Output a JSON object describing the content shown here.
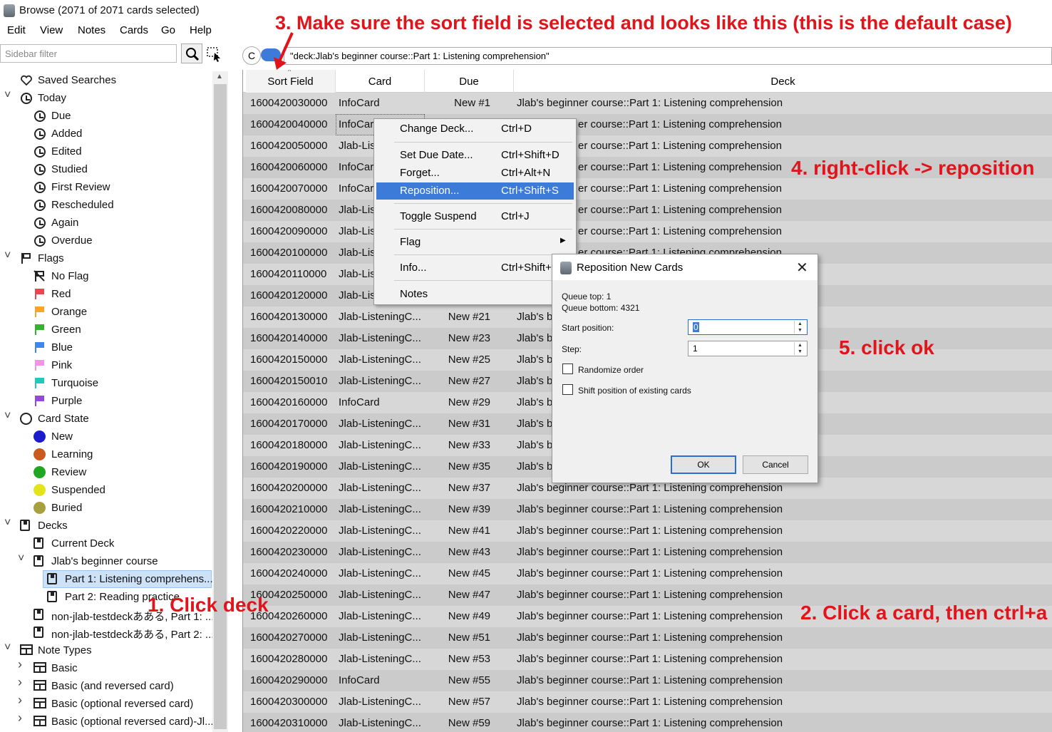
{
  "window": {
    "title": "Browse (2071 of 2071 cards selected)"
  },
  "menubar": {
    "items": [
      "Edit",
      "View",
      "Notes",
      "Cards",
      "Go",
      "Help"
    ]
  },
  "sidebar": {
    "filter_placeholder": "Sidebar filter",
    "tree": [
      {
        "label": "Saved Searches",
        "icon": "heart-icon"
      },
      {
        "label": "Today",
        "icon": "clock-icon"
      },
      {
        "label": "Due",
        "icon": "clock-icon"
      },
      {
        "label": "Added",
        "icon": "clock-icon"
      },
      {
        "label": "Edited",
        "icon": "clock-icon"
      },
      {
        "label": "Studied",
        "icon": "clock-icon"
      },
      {
        "label": "First Review",
        "icon": "clock-icon"
      },
      {
        "label": "Rescheduled",
        "icon": "clock-icon"
      },
      {
        "label": "Again",
        "icon": "clock-icon"
      },
      {
        "label": "Overdue",
        "icon": "clock-icon"
      },
      {
        "label": "Flags",
        "icon": "flag-icon"
      },
      {
        "label": "No Flag",
        "icon": "no-flag-icon"
      },
      {
        "label": "Red",
        "icon": "flag-icon",
        "color": "#e8474d"
      },
      {
        "label": "Orange",
        "icon": "flag-icon",
        "color": "#f5a623"
      },
      {
        "label": "Green",
        "icon": "flag-icon",
        "color": "#35b22f"
      },
      {
        "label": "Blue",
        "icon": "flag-icon",
        "color": "#3f86ee"
      },
      {
        "label": "Pink",
        "icon": "flag-icon",
        "color": "#f293e7"
      },
      {
        "label": "Turquoise",
        "icon": "flag-icon",
        "color": "#22c8b9"
      },
      {
        "label": "Purple",
        "icon": "flag-icon",
        "color": "#9449d9"
      },
      {
        "label": "Card State",
        "icon": "circle-icon"
      },
      {
        "label": "New",
        "icon": "dot-icon",
        "color": "#1c1ccc"
      },
      {
        "label": "Learning",
        "icon": "dot-icon",
        "color": "#cc5a1c"
      },
      {
        "label": "Review",
        "icon": "dot-icon",
        "color": "#1fa81f"
      },
      {
        "label": "Suspended",
        "icon": "dot-icon",
        "color": "#e4e41a"
      },
      {
        "label": "Buried",
        "icon": "dot-icon",
        "color": "#a8a03e"
      },
      {
        "label": "Decks",
        "icon": "deck-icon"
      },
      {
        "label": "Current Deck",
        "icon": "current-deck-icon"
      },
      {
        "label": "Jlab's beginner course",
        "icon": "deck-icon"
      },
      {
        "label": "Part 1: Listening comprehens...",
        "icon": "deck-icon"
      },
      {
        "label": "Part 2: Reading practice",
        "icon": "deck-icon"
      },
      {
        "label": "non-jlab-testdeckあある, Part 1: ...",
        "icon": "deck-icon"
      },
      {
        "label": "non-jlab-testdeckあある, Part 2: ...",
        "icon": "deck-icon"
      },
      {
        "label": "Note Types",
        "icon": "notetype-icon"
      },
      {
        "label": "Basic",
        "icon": "notetype-icon"
      },
      {
        "label": "Basic (and reversed card)",
        "icon": "notetype-icon"
      },
      {
        "label": "Basic (optional reversed card)",
        "icon": "notetype-icon"
      },
      {
        "label": "Basic (optional reversed card)-Jl...",
        "icon": "notetype-icon"
      }
    ]
  },
  "search": {
    "mode_button": "C",
    "query": "\"deck:Jlab's beginner course::Part 1: Listening comprehension\""
  },
  "table": {
    "columns": [
      "Sort Field",
      "Card",
      "Due",
      "Deck"
    ],
    "rows": [
      [
        "1600420030000",
        "InfoCard",
        "New #1",
        "Jlab's beginner course::Part 1: Listening comprehension"
      ],
      [
        "1600420040000",
        "InfoCar",
        "",
        "er course::Part 1: Listening comprehension"
      ],
      [
        "1600420050000",
        "Jlab-Lis",
        "",
        "er course::Part 1: Listening comprehension"
      ],
      [
        "1600420060000",
        "InfoCar",
        "",
        "er course::Part 1: Listening comprehension"
      ],
      [
        "1600420070000",
        "InfoCar",
        "",
        "er course::Part 1: Listening comprehension"
      ],
      [
        "1600420080000",
        "Jlab-Lis",
        "",
        "er course::Part 1: Listening comprehension"
      ],
      [
        "1600420090000",
        "Jlab-Lis",
        "",
        "er course::Part 1: Listening comprehension"
      ],
      [
        "1600420100000",
        "Jlab-Lis",
        "",
        "er course::Part 1: Listening comprehension"
      ],
      [
        "1600420110000",
        "Jlab-Lis",
        "",
        ""
      ],
      [
        "1600420120000",
        "Jlab-Lis",
        "",
        ""
      ],
      [
        "1600420130000",
        "Jlab-ListeningC...",
        "New #21",
        "Jlab's b"
      ],
      [
        "1600420140000",
        "Jlab-ListeningC...",
        "New #23",
        "Jlab's b"
      ],
      [
        "1600420150000",
        "Jlab-ListeningC...",
        "New #25",
        "Jlab's b"
      ],
      [
        "1600420150010",
        "Jlab-ListeningC...",
        "New #27",
        "Jlab's b"
      ],
      [
        "1600420160000",
        "InfoCard",
        "New #29",
        "Jlab's b"
      ],
      [
        "1600420170000",
        "Jlab-ListeningC...",
        "New #31",
        "Jlab's b"
      ],
      [
        "1600420180000",
        "Jlab-ListeningC...",
        "New #33",
        "Jlab's b"
      ],
      [
        "1600420190000",
        "Jlab-ListeningC...",
        "New #35",
        "Jlab's b"
      ],
      [
        "1600420200000",
        "Jlab-ListeningC...",
        "New #37",
        "Jlab's beginner course::Part 1: Listening comprehension"
      ],
      [
        "1600420210000",
        "Jlab-ListeningC...",
        "New #39",
        "Jlab's beginner course::Part 1: Listening comprehension"
      ],
      [
        "1600420220000",
        "Jlab-ListeningC...",
        "New #41",
        "Jlab's beginner course::Part 1: Listening comprehension"
      ],
      [
        "1600420230000",
        "Jlab-ListeningC...",
        "New #43",
        "Jlab's beginner course::Part 1: Listening comprehension"
      ],
      [
        "1600420240000",
        "Jlab-ListeningC...",
        "New #45",
        "Jlab's beginner course::Part 1: Listening comprehension"
      ],
      [
        "1600420250000",
        "Jlab-ListeningC...",
        "New #47",
        "Jlab's beginner course::Part 1: Listening comprehension"
      ],
      [
        "1600420260000",
        "Jlab-ListeningC...",
        "New #49",
        "Jlab's beginner course::Part 1: Listening comprehension"
      ],
      [
        "1600420270000",
        "Jlab-ListeningC...",
        "New #51",
        "Jlab's beginner course::Part 1: Listening comprehension"
      ],
      [
        "1600420280000",
        "Jlab-ListeningC...",
        "New #53",
        "Jlab's beginner course::Part 1: Listening comprehension"
      ],
      [
        "1600420290000",
        "InfoCard",
        "New #55",
        "Jlab's beginner course::Part 1: Listening comprehension"
      ],
      [
        "1600420300000",
        "Jlab-ListeningC...",
        "New #57",
        "Jlab's beginner course::Part 1: Listening comprehension"
      ],
      [
        "1600420310000",
        "Jlab-ListeningC...",
        "New #59",
        "Jlab's beginner course::Part 1: Listening comprehension"
      ]
    ]
  },
  "context_menu": {
    "items": [
      {
        "label": "Change Deck...",
        "shortcut": "Ctrl+D"
      },
      {
        "label": "Set Due Date...",
        "shortcut": "Ctrl+Shift+D"
      },
      {
        "label": "Forget...",
        "shortcut": "Ctrl+Alt+N"
      },
      {
        "label": "Reposition...",
        "shortcut": "Ctrl+Shift+S"
      },
      {
        "label": "Toggle Suspend",
        "shortcut": "Ctrl+J"
      },
      {
        "label": "Flag",
        "shortcut": ""
      },
      {
        "label": "Info...",
        "shortcut": "Ctrl+Shift+"
      },
      {
        "label": "Notes",
        "shortcut": ""
      }
    ]
  },
  "dialog": {
    "title": "Reposition New Cards",
    "queue_top": "Queue top: 1",
    "queue_bottom": "Queue bottom: 4321",
    "start_label": "Start position:",
    "start_value": "0",
    "step_label": "Step:",
    "step_value": "1",
    "randomize_label": "Randomize order",
    "shift_label": "Shift position of existing cards",
    "ok": "OK",
    "cancel": "Cancel"
  },
  "annotations": {
    "step1": "1. Click deck",
    "step2": "2. Click a card, then ctrl+a",
    "step3": "3. Make sure the sort field is selected and looks like this (this is the default case)",
    "step4": "4. right-click -> reposition",
    "step5": "5. click ok",
    "color": "#e0151b"
  }
}
